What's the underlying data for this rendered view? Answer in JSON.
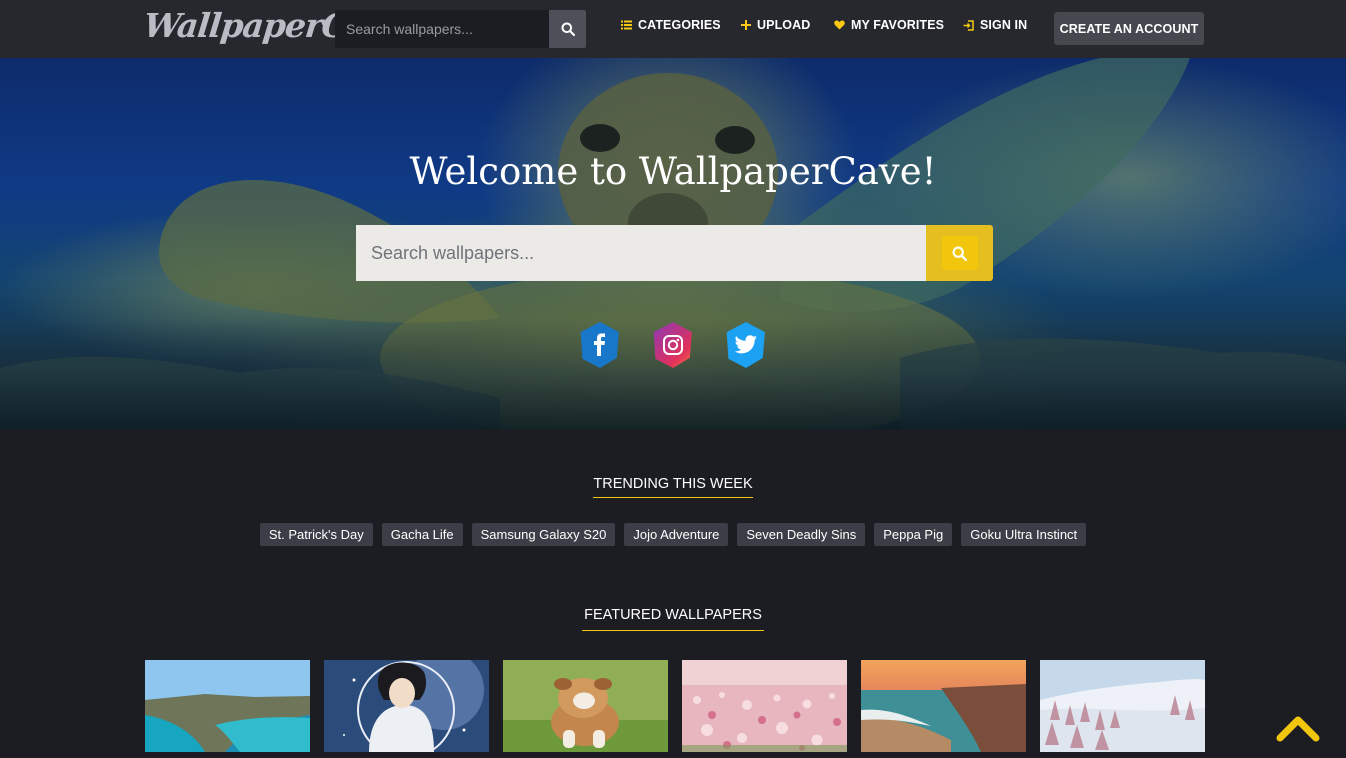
{
  "navbar": {
    "logo": "WallpaperCave",
    "search_placeholder": "Search wallpapers...",
    "links": [
      {
        "label": "CATEGORIES",
        "icon": "list-icon"
      },
      {
        "label": "UPLOAD",
        "icon": "plus-icon"
      },
      {
        "label": "MY FAVORITES",
        "icon": "heart-icon"
      },
      {
        "label": "SIGN IN",
        "icon": "sign-in-icon"
      }
    ],
    "create_account": "CREATE AN ACCOUNT"
  },
  "hero": {
    "title": "Welcome to WallpaperCave!",
    "search_placeholder": "Search wallpapers...",
    "social": [
      "facebook-icon",
      "instagram-icon",
      "twitter-icon"
    ]
  },
  "trending": {
    "title": "TRENDING THIS WEEK",
    "tags": [
      "St. Patrick's Day",
      "Gacha Life",
      "Samsung Galaxy S20",
      "Jojo Adventure",
      "Seven Deadly Sins",
      "Peppa Pig",
      "Goku Ultra Instinct"
    ]
  },
  "featured": {
    "title": "FEATURED WALLPAPERS",
    "thumbnails": [
      "coastline-cliffs",
      "anime-character",
      "bulldog-puppy",
      "pink-flower-field",
      "sunset-beach",
      "snowy-forest"
    ]
  },
  "colors": {
    "accent": "#f1c60d",
    "navbar_bg": "#26282e",
    "page_bg": "#1b1d23",
    "tag_bg": "#3b3e46"
  }
}
